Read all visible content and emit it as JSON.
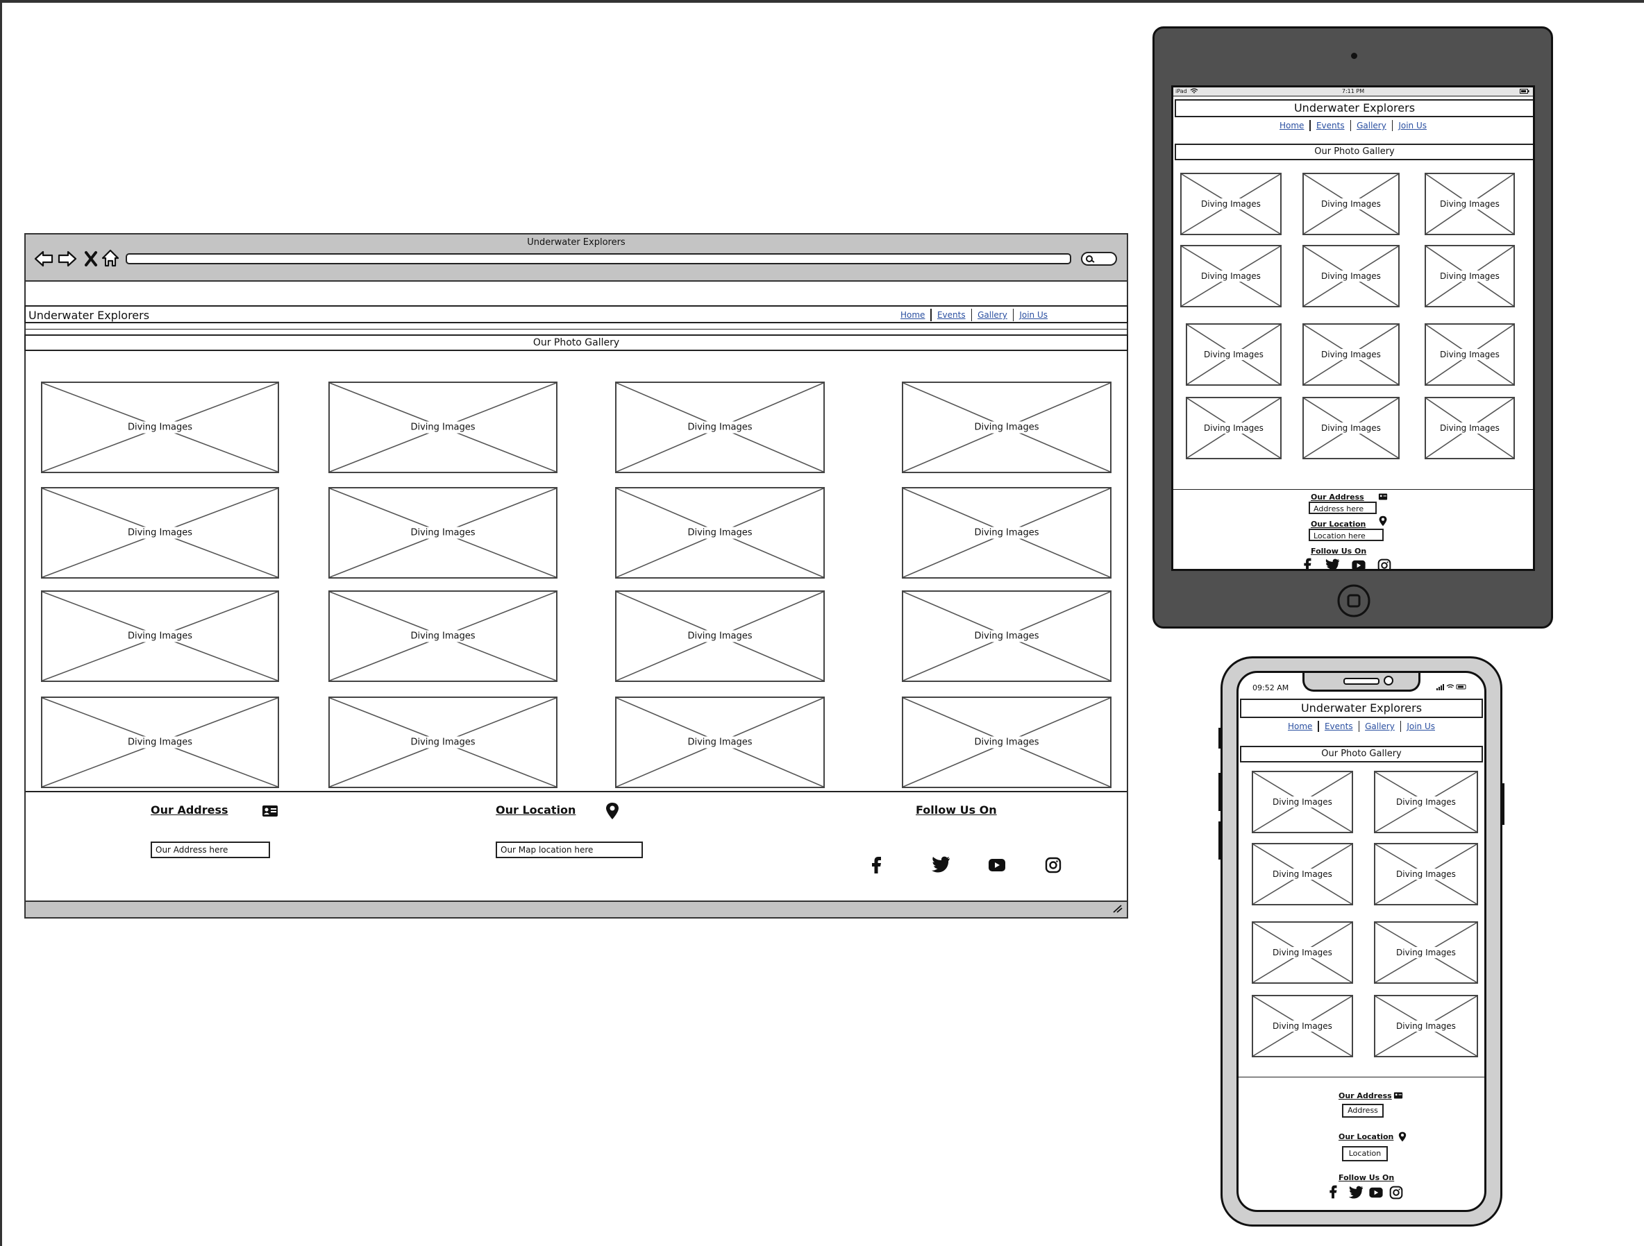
{
  "app_title": "Underwater Explorers",
  "nav": [
    "Home",
    "Events",
    "Gallery",
    "Join Us"
  ],
  "gallery_title": "Our Photo Gallery",
  "image_label": "Diving Images",
  "colors": {
    "link": "#2a4fa0",
    "chrome": "#c4c4c4",
    "tablet_bezel": "#505050",
    "phone_body": "#cfcfcf"
  },
  "icons": {
    "back": "back-arrow-icon",
    "forward": "forward-arrow-icon",
    "close": "close-x-icon",
    "home": "home-icon",
    "search": "search-icon",
    "address": "id-card-icon",
    "location": "map-pin-icon",
    "social": [
      "facebook-icon",
      "twitter-icon",
      "youtube-icon",
      "instagram-icon"
    ]
  },
  "desktop": {
    "window_title": "Underwater Explorers",
    "address_title": "Our Address",
    "address_value": "Our Address here",
    "location_title": "Our Location",
    "location_value": "Our Map location here",
    "follow_title": "Follow Us On",
    "image_count": 16
  },
  "tablet": {
    "status_device": "iPad",
    "status_time": "7:11 PM",
    "address_title": "Our Address",
    "address_value": "Address here",
    "location_title": "Our Location",
    "location_value": "Location here",
    "follow_title": "Follow Us On",
    "image_count": 12
  },
  "phone": {
    "status_time": "09:52 AM",
    "address_title": "Our Address",
    "address_value": "Address",
    "location_title": "Our Location",
    "location_value": "Location",
    "follow_title": "Follow Us On",
    "image_count": 8
  }
}
